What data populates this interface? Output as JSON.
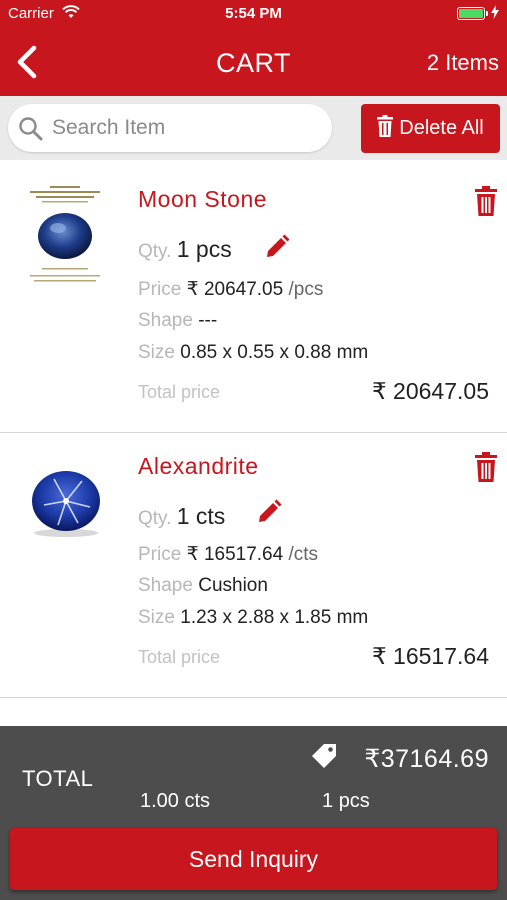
{
  "status_bar": {
    "carrier": "Carrier",
    "time": "5:54 PM",
    "battery_level": 1.0
  },
  "nav": {
    "title": "CART",
    "item_count": "2 Items"
  },
  "search": {
    "placeholder": "Search Item",
    "delete_all_label": "Delete All"
  },
  "labels": {
    "qty": "Qty.",
    "price": "Price",
    "shape": "Shape",
    "size": "Size",
    "total_price": "Total price"
  },
  "items": [
    {
      "name": "Moon Stone",
      "qty": "1 pcs",
      "price": "₹ 20647.05",
      "price_unit": "/pcs",
      "shape": "---",
      "size": "0.85 x 0.55 x 0.88 mm",
      "total": "₹ 20647.05"
    },
    {
      "name": "Alexandrite",
      "qty": "1 cts",
      "price": "₹ 16517.64",
      "price_unit": "/cts",
      "shape": "Cushion",
      "size": "1.23 x 2.88 x 1.85 mm",
      "total": "₹ 16517.64"
    }
  ],
  "summary": {
    "label": "TOTAL",
    "amount": "₹37164.69",
    "cts_value": "1.00",
    "cts_unit": "cts",
    "pcs_value": "1",
    "pcs_unit": "pcs"
  },
  "actions": {
    "send_inquiry": "Send Inquiry"
  },
  "colors": {
    "brand_red": "#c7161e",
    "summary_bg": "#4d4d4d",
    "search_bg": "#eaeaea",
    "label_gray": "#b7b7b7"
  }
}
